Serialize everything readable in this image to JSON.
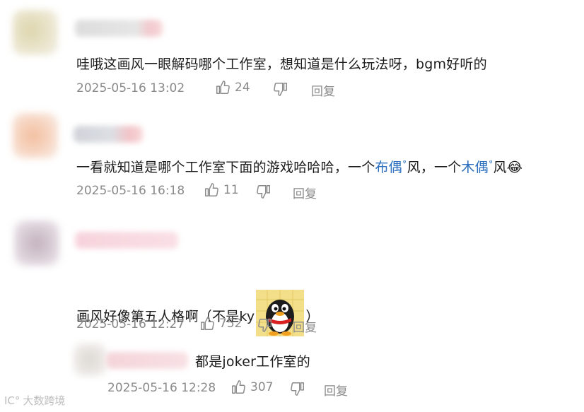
{
  "comments": [
    {
      "text": "哇哦这画风一眼解码哪个工作室，想知道是什么玩法呀，bgm好听的",
      "timestamp": "2025-05-16 13:02",
      "likes": "24",
      "reply_label": "回复"
    },
    {
      "text_parts": [
        "一看就知道是哪个工作室下面的游戏哈哈哈，一个",
        "布偶",
        "风，一个",
        "木偶",
        "风"
      ],
      "emoji": "😂",
      "timestamp": "2025-05-16 16:18",
      "likes": "11",
      "reply_label": "回复"
    },
    {
      "text_before": "画风好像第五人格啊（不是ky",
      "text_after": "）",
      "timestamp": "2025-05-16 12:27",
      "likes": "752",
      "reply_label": "回复"
    },
    {
      "text": "都是joker工作室的",
      "timestamp": "2025-05-16 12:28",
      "likes": "307",
      "reply_label": "回复"
    }
  ],
  "search_mark": "ᵠ",
  "watermark": "大数跨境",
  "watermark_logo": "IC°"
}
